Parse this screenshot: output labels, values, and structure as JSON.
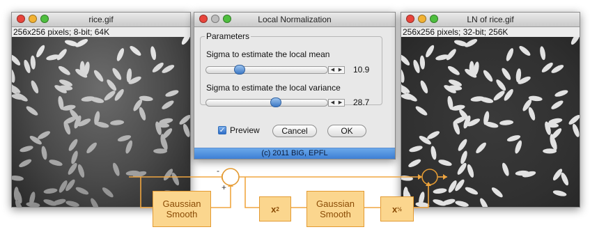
{
  "left_window": {
    "title": "rice.gif",
    "info": "256x256 pixels; 8-bit; 64K"
  },
  "right_window": {
    "title": "LN of rice.gif",
    "info": "256x256 pixels; 32-bit; 256K"
  },
  "dialog": {
    "title": "Local Normalization",
    "group_label": "Parameters",
    "sigma_mean_label": "Sigma to estimate the local mean",
    "sigma_mean_value": "10.9",
    "sigma_mean_fraction": 0.27,
    "sigma_var_label": "Sigma to estimate the local variance",
    "sigma_var_value": "28.7",
    "sigma_var_fraction": 0.57,
    "preview_label": "Preview",
    "preview_checked": true,
    "cancel_label": "Cancel",
    "ok_label": "OK",
    "footer": "(c) 2011 BIG, EPFL"
  },
  "diagram": {
    "minus_sign": "-",
    "plus_sign": "+",
    "gaussian1_line1": "Gaussian",
    "gaussian1_line2": "Smooth",
    "square_label": "x",
    "square_exp": "2",
    "gaussian2_line1": "Gaussian",
    "gaussian2_line2": "Smooth",
    "sqrt_label": "x",
    "sqrt_exp": "½",
    "line_color": "#f0a640",
    "node_fill": "#fbd68e"
  },
  "colors": {
    "close": "#e8453c",
    "minimize": "#f2b233",
    "zoom": "#4fbf3f",
    "inactive": "#bdbdbd"
  }
}
